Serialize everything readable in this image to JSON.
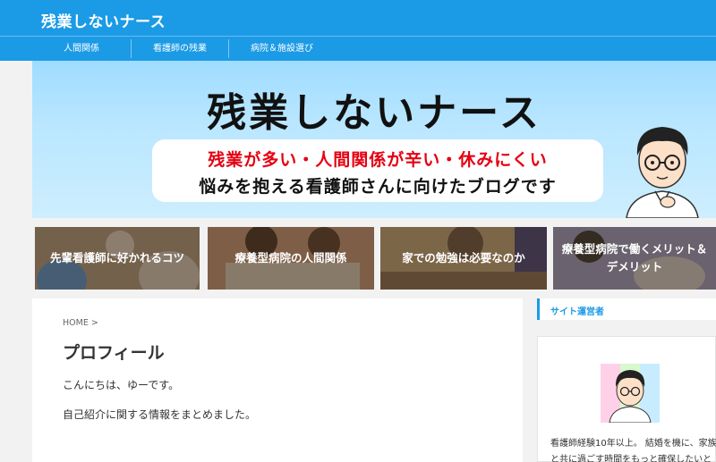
{
  "header": {
    "site_title": "残業しないナース"
  },
  "nav": {
    "items": [
      {
        "label": "人間関係"
      },
      {
        "label": "看護師の残業"
      },
      {
        "label": "病院＆施設選び"
      }
    ]
  },
  "banner": {
    "title": "残業しないナース",
    "subtitle_line1": "残業が多い・人間関係が辛い・休みにくい",
    "subtitle_line2": "悩みを抱える看護師さんに向けたブログです"
  },
  "featured": [
    {
      "title": "先輩看護師に好かれるコツ",
      "color": "#c9a882"
    },
    {
      "title": "療養型病院の人間関係",
      "color": "#d9a37a"
    },
    {
      "title": "家での勉強は必要なのか",
      "color": "#d6b07d"
    },
    {
      "title": "療養型病院で働くメリット＆デメリット",
      "color": "#b7a9bd"
    }
  ],
  "main": {
    "breadcrumb": "HOME >",
    "page_title": "プロフィール",
    "paragraphs": [
      "こんにちは、ゆーです。",
      "自己紹介に関する情報をまとめました。"
    ]
  },
  "sidebar": {
    "heading": "サイト運営者",
    "profile_lines": [
      "看護師経験10年以上。 結婚を機に、家族",
      "と共に過ごす時間をもっと確保したいと"
    ]
  },
  "colors": {
    "accent": "#1b9ae6",
    "banner_red": "#e60012"
  }
}
